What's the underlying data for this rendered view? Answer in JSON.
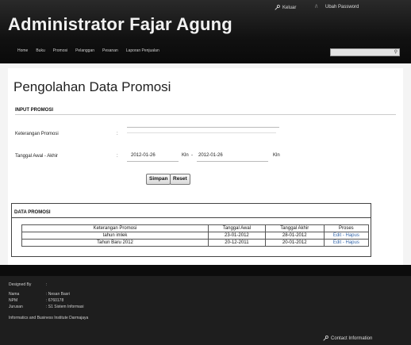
{
  "header": {
    "title": "Administrator Fajar Agung",
    "keluar_label": "Keluar",
    "ubah_password_label": "Ubah Password",
    "separator": "/\\"
  },
  "nav": {
    "items": [
      "Home",
      "Buku",
      "Promosi",
      "Pelanggan",
      "Pesanan",
      "Laporan Penjualan"
    ]
  },
  "main": {
    "page_title": "Pengolahan Data Promosi",
    "input_section_title": "INPUT PROMOSI",
    "keterangan_label": "Keterangan Promosi",
    "keterangan_value": "",
    "tanggal_label": "Tanggal Awal - Akhir",
    "colon": ":",
    "date_start": "2012-01-26",
    "date_end": "2012-01-26",
    "kal_label": "Kln",
    "dash": "-",
    "simpan_label": "Simpan",
    "reset_label": "Reset"
  },
  "data_promosi": {
    "title": "DATA PROMOSI",
    "columns": [
      "Keterangan Promosi",
      "Tanggal Awal",
      "Tanggal Akhir",
      "Proses"
    ],
    "rows": [
      {
        "keterangan": "tahun imlek",
        "awal": "23-01-2012",
        "akhir": "28-01-2012",
        "proses": "Edit - Hapus"
      },
      {
        "keterangan": "Tahun Baru 2012",
        "awal": "20-12-2011",
        "akhir": "20-01-2012",
        "proses": "Edit - Hapus"
      }
    ]
  },
  "footer": {
    "designed_by": "Designed By",
    "nama_label": "Nama",
    "nama_value": ": Nesan Basri",
    "npm_label": "NPM",
    "npm_value": ": 6760178",
    "jurusan_label": "Jurusan",
    "jurusan_value": ": S1 Sistem Informasi",
    "institution": "Informatics and Business Institute Darmajaya",
    "contact_label": "Contact Information"
  }
}
